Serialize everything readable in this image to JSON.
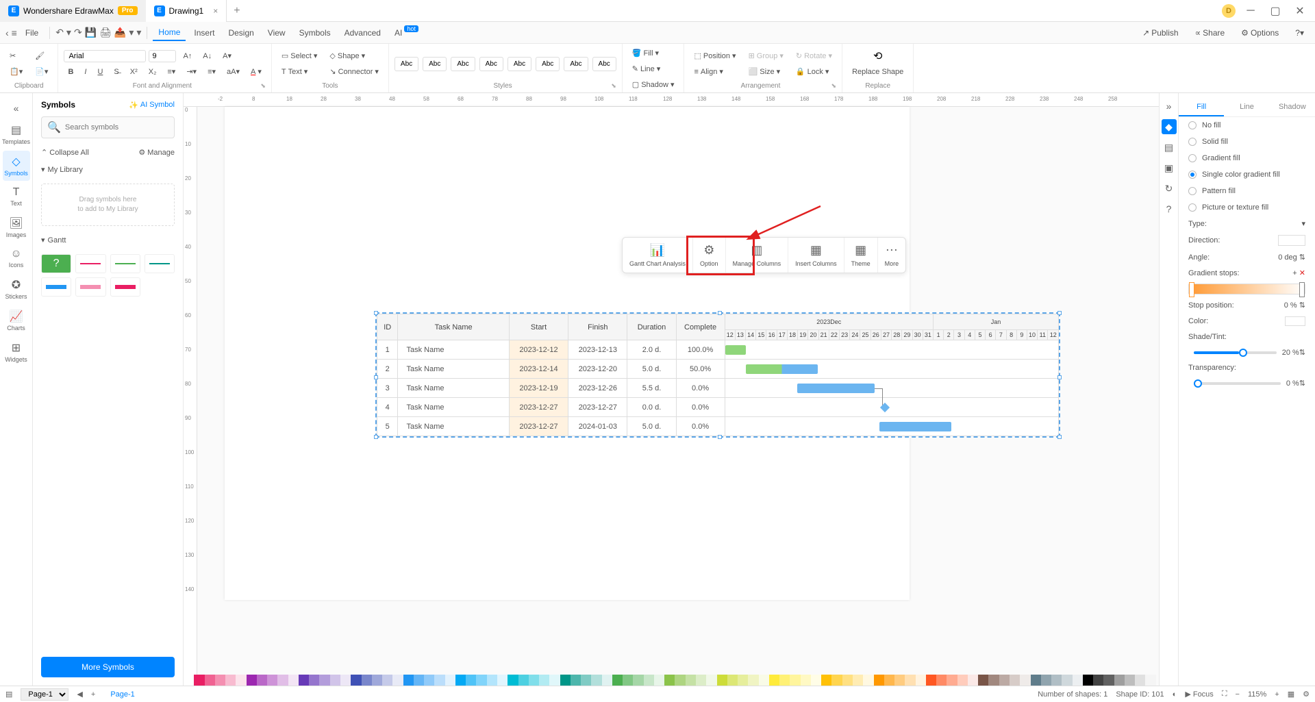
{
  "titlebar": {
    "app_name": "Wondershare EdrawMax",
    "pro": "Pro",
    "doc_tab": "Drawing1",
    "avatar": "D"
  },
  "menubar": {
    "file": "File",
    "items": [
      "Home",
      "Insert",
      "Design",
      "View",
      "Symbols",
      "Advanced",
      "AI"
    ],
    "hot": "hot",
    "right": [
      "Publish",
      "Share",
      "Options"
    ]
  },
  "ribbon": {
    "clipboard": "Clipboard",
    "font_name": "Arial",
    "font_size": "9",
    "fontalign": "Font and Alignment",
    "tools": "Tools",
    "select": "Select",
    "shape": "Shape",
    "text": "Text",
    "connector": "Connector",
    "styles": "Styles",
    "style_label": "Abc",
    "fill": "Fill",
    "line": "Line",
    "shadow": "Shadow",
    "arrangement": "Arrangement",
    "position": "Position",
    "align": "Align",
    "group": "Group",
    "size": "Size",
    "rotate": "Rotate",
    "lock": "Lock",
    "replace_shape": "Replace Shape",
    "replace": "Replace"
  },
  "leftbar": {
    "items": [
      "Templates",
      "Symbols",
      "Text",
      "Images",
      "Icons",
      "Stickers",
      "Charts",
      "Widgets"
    ]
  },
  "symbols_panel": {
    "title": "Symbols",
    "ai": "AI Symbol",
    "search_ph": "Search symbols",
    "collapse": "Collapse All",
    "manage": "Manage",
    "mylib": "My Library",
    "drop1": "Drag symbols here",
    "drop2": "to add to My Library",
    "gantt": "Gantt",
    "more": "More Symbols"
  },
  "float_toolbar": {
    "items": [
      "Gantt Chart Analysis",
      "Option",
      "Manage Columns",
      "Insert Columns",
      "Theme",
      "More"
    ]
  },
  "gantt": {
    "headers": [
      "ID",
      "Task Name",
      "Start",
      "Finish",
      "Duration",
      "Complete"
    ],
    "month1": "2023Dec",
    "month2": "Jan",
    "days": [
      "12",
      "13",
      "14",
      "15",
      "16",
      "17",
      "18",
      "19",
      "20",
      "21",
      "22",
      "23",
      "24",
      "25",
      "26",
      "27",
      "28",
      "29",
      "30",
      "31",
      "1",
      "2",
      "3",
      "4",
      "5",
      "6",
      "7",
      "8",
      "9",
      "10",
      "11",
      "12"
    ],
    "rows": [
      {
        "id": "1",
        "name": "Task Name",
        "start": "2023-12-12",
        "finish": "2023-12-13",
        "dur": "2.0 d.",
        "comp": "100.0%"
      },
      {
        "id": "2",
        "name": "Task Name",
        "start": "2023-12-14",
        "finish": "2023-12-20",
        "dur": "5.0 d.",
        "comp": "50.0%"
      },
      {
        "id": "3",
        "name": "Task Name",
        "start": "2023-12-19",
        "finish": "2023-12-26",
        "dur": "5.5 d.",
        "comp": "0.0%"
      },
      {
        "id": "4",
        "name": "Task Name",
        "start": "2023-12-27",
        "finish": "2023-12-27",
        "dur": "0.0 d.",
        "comp": "0.0%"
      },
      {
        "id": "5",
        "name": "Task Name",
        "start": "2023-12-27",
        "finish": "2024-01-03",
        "dur": "5.0 d.",
        "comp": "0.0%"
      }
    ]
  },
  "right_panel": {
    "tabs": [
      "Fill",
      "Line",
      "Shadow"
    ],
    "nofill": "No fill",
    "solid": "Solid fill",
    "gradient": "Gradient fill",
    "single_grad": "Single color gradient fill",
    "pattern": "Pattern fill",
    "picture": "Picture or texture fill",
    "type": "Type:",
    "direction": "Direction:",
    "angle": "Angle:",
    "angle_val": "0 deg",
    "stops": "Gradient stops:",
    "stop_pos": "Stop position:",
    "stop_pos_val": "0 %",
    "color": "Color:",
    "shade": "Shade/Tint:",
    "shade_val": "20 %",
    "transp": "Transparency:",
    "transp_val": "0 %"
  },
  "statusbar": {
    "page_sel": "Page-1",
    "page_tab": "Page-1",
    "shapes": "Number of shapes: 1",
    "shape_id": "Shape ID: 101",
    "focus": "Focus",
    "zoom": "115%"
  },
  "colors": [
    "#ffffff",
    "#e91e63",
    "#f06292",
    "#f48fb1",
    "#f8bbd0",
    "#fce4ec",
    "#9c27b0",
    "#ba68c8",
    "#ce93d8",
    "#e1bee7",
    "#f3e5f5",
    "#673ab7",
    "#9575cd",
    "#b39ddb",
    "#d1c4e9",
    "#ede7f6",
    "#3f51b5",
    "#7986cb",
    "#9fa8da",
    "#c5cae9",
    "#e8eaf6",
    "#2196f3",
    "#64b5f6",
    "#90caf9",
    "#bbdefb",
    "#e3f2fd",
    "#03a9f4",
    "#4fc3f7",
    "#81d4fa",
    "#b3e5fc",
    "#e1f5fe",
    "#00bcd4",
    "#4dd0e1",
    "#80deea",
    "#b2ebf2",
    "#e0f7fa",
    "#009688",
    "#4db6ac",
    "#80cbc4",
    "#b2dfdb",
    "#e0f2f1",
    "#4caf50",
    "#81c784",
    "#a5d6a7",
    "#c8e6c9",
    "#e8f5e9",
    "#8bc34a",
    "#aed581",
    "#c5e1a5",
    "#dcedc8",
    "#f1f8e9",
    "#cddc39",
    "#dce775",
    "#e6ee9c",
    "#f0f4c3",
    "#f9fbe7",
    "#ffeb3b",
    "#fff176",
    "#fff59d",
    "#fff9c4",
    "#fffde7",
    "#ffc107",
    "#ffd54f",
    "#ffe082",
    "#ffecb3",
    "#fff8e1",
    "#ff9800",
    "#ffb74d",
    "#ffcc80",
    "#ffe0b2",
    "#fff3e0",
    "#ff5722",
    "#ff8a65",
    "#ffab91",
    "#ffccbc",
    "#fbe9e7",
    "#795548",
    "#a1887f",
    "#bcaaa4",
    "#d7ccc8",
    "#efebe9",
    "#607d8b",
    "#90a4ae",
    "#b0bec5",
    "#cfd8dc",
    "#eceff1",
    "#000000",
    "#424242",
    "#616161",
    "#9e9e9e",
    "#bdbdbd",
    "#e0e0e0",
    "#f5f5f5"
  ]
}
